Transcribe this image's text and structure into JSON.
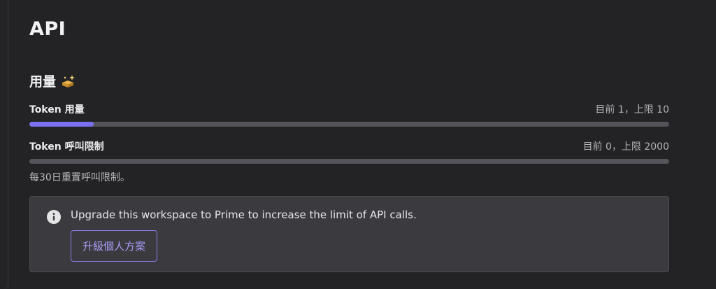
{
  "page": {
    "title": "API"
  },
  "usage_section": {
    "title": "用量",
    "icon": "sparkle-icon"
  },
  "meters": [
    {
      "label": "Token 用量",
      "value_text": "目前 1，上限 10",
      "current": 1,
      "limit": 10,
      "fill_color": "#7b6ff2"
    },
    {
      "label": "Token 呼叫限制",
      "value_text": "目前 0，上限 2000",
      "current": 0,
      "limit": 2000,
      "fill_color": "#7b6ff2"
    }
  ],
  "reset_note": "每30日重置呼叫限制。",
  "notice": {
    "icon": "info-icon",
    "text": "Upgrade this workspace to Prime to increase the limit of API calls.",
    "button_label": "升級個人方案"
  },
  "colors": {
    "background": "#232225",
    "accent": "#7b6ff2",
    "track": "#55545a",
    "notice_background": "#3b3a3f"
  }
}
